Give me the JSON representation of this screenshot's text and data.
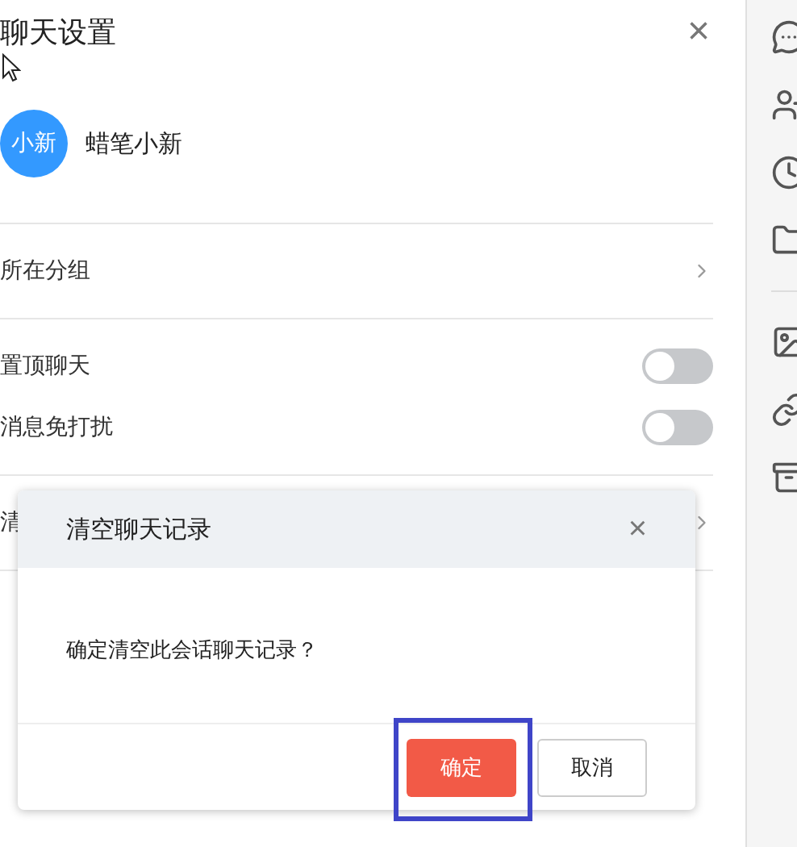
{
  "panel": {
    "title": "聊天设置",
    "close": "×"
  },
  "contact": {
    "avatar_text": "小新",
    "name": "蜡笔小新"
  },
  "rows": [
    {
      "kind": "link",
      "label": "所在分组"
    },
    {
      "kind": "toggle",
      "label": "置顶聊天",
      "on": false
    },
    {
      "kind": "toggle",
      "label": "消息免打扰",
      "on": false
    },
    {
      "kind": "link",
      "label": "清"
    }
  ],
  "dialog": {
    "title": "清空聊天记录",
    "close": "×",
    "message": "确定清空此会话聊天记录？",
    "buttons": [
      {
        "kind": "primary",
        "label": "确定",
        "highlighted": true
      },
      {
        "kind": "secondary",
        "label": "取消"
      }
    ]
  }
}
